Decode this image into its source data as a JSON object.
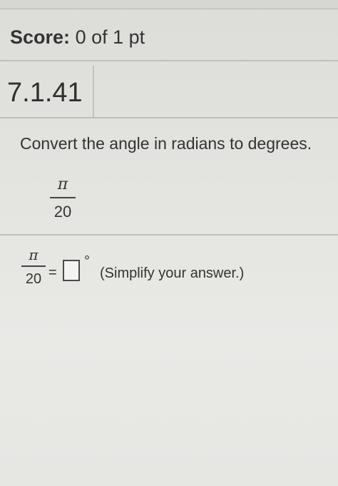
{
  "score": {
    "label": "Score:",
    "value": "0 of 1 pt"
  },
  "question": {
    "number": "7.1.41",
    "instruction": "Convert the angle in radians to degrees.",
    "angle": {
      "numerator": "π",
      "denominator": "20"
    }
  },
  "answer_row": {
    "numerator": "π",
    "denominator": "20",
    "equals": "=",
    "input_value": "",
    "unit_symbol": "°",
    "hint": "(Simplify your answer.)"
  }
}
